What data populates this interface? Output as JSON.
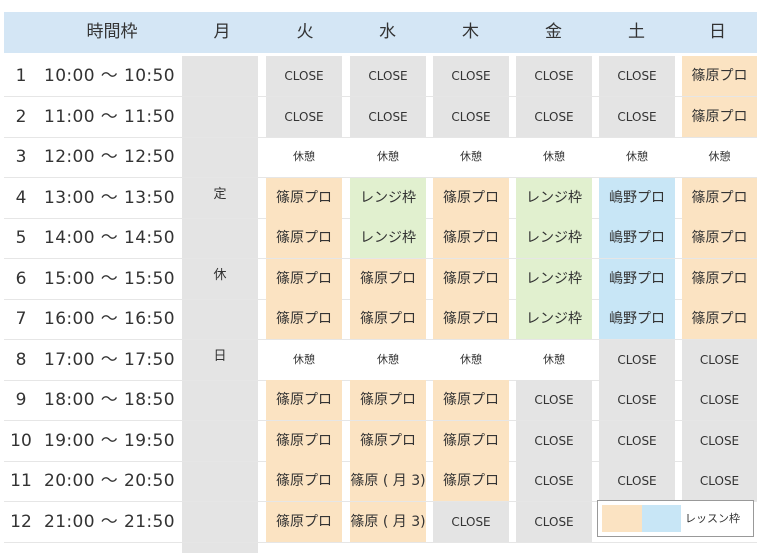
{
  "header": {
    "time_label": "時間枠",
    "days": [
      "月",
      "火",
      "水",
      "木",
      "金",
      "土",
      "日"
    ]
  },
  "monday": {
    "labels": [
      "定",
      "休",
      "日"
    ]
  },
  "rows": [
    {
      "num": "1",
      "time": "10:00 ～ 10:50",
      "cells": [
        {
          "text": "CLOSE",
          "color": "gray"
        },
        {
          "text": "CLOSE",
          "color": "gray"
        },
        {
          "text": "CLOSE",
          "color": "gray"
        },
        {
          "text": "CLOSE",
          "color": "gray"
        },
        {
          "text": "CLOSE",
          "color": "gray"
        },
        {
          "text": "篠原プロ",
          "color": "orange"
        }
      ]
    },
    {
      "num": "2",
      "time": "11:00 ～ 11:50",
      "cells": [
        {
          "text": "CLOSE",
          "color": "gray"
        },
        {
          "text": "CLOSE",
          "color": "gray"
        },
        {
          "text": "CLOSE",
          "color": "gray"
        },
        {
          "text": "CLOSE",
          "color": "gray"
        },
        {
          "text": "CLOSE",
          "color": "gray"
        },
        {
          "text": "篠原プロ",
          "color": "orange"
        }
      ]
    },
    {
      "num": "3",
      "time": "12:00 ～ 12:50",
      "cells": [
        {
          "text": "休憩",
          "color": "white"
        },
        {
          "text": "休憩",
          "color": "white"
        },
        {
          "text": "休憩",
          "color": "white"
        },
        {
          "text": "休憩",
          "color": "white"
        },
        {
          "text": "休憩",
          "color": "white"
        },
        {
          "text": "休憩",
          "color": "white"
        }
      ]
    },
    {
      "num": "4",
      "time": "13:00 ～ 13:50",
      "cells": [
        {
          "text": "篠原プロ",
          "color": "orange"
        },
        {
          "text": "レンジ枠",
          "color": "green"
        },
        {
          "text": "篠原プロ",
          "color": "orange"
        },
        {
          "text": "レンジ枠",
          "color": "green"
        },
        {
          "text": "嶋野プロ",
          "color": "blue"
        },
        {
          "text": "篠原プロ",
          "color": "orange"
        }
      ]
    },
    {
      "num": "5",
      "time": "14:00 ～ 14:50",
      "cells": [
        {
          "text": "篠原プロ",
          "color": "orange"
        },
        {
          "text": "レンジ枠",
          "color": "green"
        },
        {
          "text": "篠原プロ",
          "color": "orange"
        },
        {
          "text": "レンジ枠",
          "color": "green"
        },
        {
          "text": "嶋野プロ",
          "color": "blue"
        },
        {
          "text": "篠原プロ",
          "color": "orange"
        }
      ]
    },
    {
      "num": "6",
      "time": "15:00 ～ 15:50",
      "cells": [
        {
          "text": "篠原プロ",
          "color": "orange"
        },
        {
          "text": "篠原プロ",
          "color": "orange"
        },
        {
          "text": "篠原プロ",
          "color": "orange"
        },
        {
          "text": "レンジ枠",
          "color": "green"
        },
        {
          "text": "嶋野プロ",
          "color": "blue"
        },
        {
          "text": "篠原プロ",
          "color": "orange"
        }
      ]
    },
    {
      "num": "7",
      "time": "16:00 ～ 16:50",
      "cells": [
        {
          "text": "篠原プロ",
          "color": "orange"
        },
        {
          "text": "篠原プロ",
          "color": "orange"
        },
        {
          "text": "篠原プロ",
          "color": "orange"
        },
        {
          "text": "レンジ枠",
          "color": "green"
        },
        {
          "text": "嶋野プロ",
          "color": "blue"
        },
        {
          "text": "篠原プロ",
          "color": "orange"
        }
      ]
    },
    {
      "num": "8",
      "time": "17:00 ～ 17:50",
      "cells": [
        {
          "text": "休憩",
          "color": "white"
        },
        {
          "text": "休憩",
          "color": "white"
        },
        {
          "text": "休憩",
          "color": "white"
        },
        {
          "text": "休憩",
          "color": "white"
        },
        {
          "text": "CLOSE",
          "color": "gray"
        },
        {
          "text": "CLOSE",
          "color": "gray"
        }
      ]
    },
    {
      "num": "9",
      "time": "18:00 ～ 18:50",
      "cells": [
        {
          "text": "篠原プロ",
          "color": "orange"
        },
        {
          "text": "篠原プロ",
          "color": "orange"
        },
        {
          "text": "篠原プロ",
          "color": "orange"
        },
        {
          "text": "CLOSE",
          "color": "gray"
        },
        {
          "text": "CLOSE",
          "color": "gray"
        },
        {
          "text": "CLOSE",
          "color": "gray"
        }
      ]
    },
    {
      "num": "10",
      "time": "19:00 ～ 19:50",
      "cells": [
        {
          "text": "篠原プロ",
          "color": "orange"
        },
        {
          "text": "篠原プロ",
          "color": "orange"
        },
        {
          "text": "篠原プロ",
          "color": "orange"
        },
        {
          "text": "CLOSE",
          "color": "gray"
        },
        {
          "text": "CLOSE",
          "color": "gray"
        },
        {
          "text": "CLOSE",
          "color": "gray"
        }
      ]
    },
    {
      "num": "11",
      "time": "20:00 ～ 20:50",
      "cells": [
        {
          "text": "篠原プロ",
          "color": "orange"
        },
        {
          "text": "篠原 ( 月 3)",
          "color": "orange"
        },
        {
          "text": "篠原プロ",
          "color": "orange"
        },
        {
          "text": "CLOSE",
          "color": "gray"
        },
        {
          "text": "CLOSE",
          "color": "gray"
        },
        {
          "text": "CLOSE",
          "color": "gray"
        }
      ]
    },
    {
      "num": "12",
      "time": "21:00 ～ 21:50",
      "cells": [
        {
          "text": "篠原プロ",
          "color": "orange"
        },
        {
          "text": "篠原 ( 月 3)",
          "color": "orange"
        },
        {
          "text": "CLOSE",
          "color": "gray"
        },
        {
          "text": "CLOSE",
          "color": "gray"
        }
      ]
    }
  ],
  "legend": {
    "label": "レッスン枠",
    "colors": [
      "orange",
      "blue"
    ]
  },
  "palette": {
    "gray": "#e4e4e4",
    "orange": "#fbe3c2",
    "green": "#e1f0cf",
    "blue": "#c8e6f6",
    "header": "#d4e6f5"
  }
}
